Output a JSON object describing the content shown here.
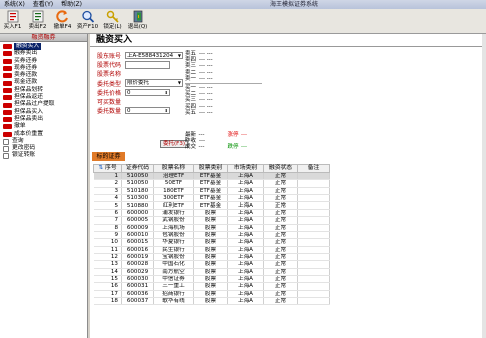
{
  "menu": [
    "系统(X)",
    "查看(Y)",
    "帮助(Z)"
  ],
  "app_title": "海王模拟证券系统",
  "toolbar": [
    {
      "label": "买入F1",
      "icon": "buy-icon"
    },
    {
      "label": "卖出F2",
      "icon": "sell-icon"
    },
    {
      "label": "撤单F4",
      "icon": "cancel-order-icon"
    },
    {
      "label": "资产F10",
      "icon": "search-icon"
    },
    {
      "label": "锁定(L)",
      "icon": "key-icon"
    },
    {
      "label": "退出(Q)",
      "icon": "exit-icon"
    }
  ],
  "sidebar": {
    "header": "融资融券",
    "items": [
      {
        "label": "融资买入",
        "selected": true
      },
      {
        "label": "融券卖出"
      },
      {
        "label": "买券还券"
      },
      {
        "label": "现券还券"
      },
      {
        "label": "卖券还款"
      },
      {
        "label": "现金还款"
      },
      {
        "label": "担保品划转"
      },
      {
        "label": "担保品返还"
      },
      {
        "label": "担保品过户提取"
      },
      {
        "label": "担保品买入"
      },
      {
        "label": "担保品卖出"
      },
      {
        "label": "撤单"
      },
      {
        "label": "成本价重置"
      },
      {
        "label": "查询",
        "tree": true
      },
      {
        "label": "更改密码",
        "tree": true
      },
      {
        "label": "银证转账",
        "tree": true
      }
    ]
  },
  "panel_title": "融资买入",
  "form": {
    "account_label": "股东账号",
    "account_value": "上A-E588431204",
    "code_label": "股票代码",
    "name_label": "股票名称",
    "type_label": "委托类型",
    "type_value": "限价委托",
    "price_label": "委托价格",
    "price_value": "0",
    "max_label": "可买数量",
    "qty_label": "委托数量",
    "qty_value": "0",
    "confirm_label": "委托(F3)"
  },
  "quote": {
    "sell": [
      {
        "k": "卖五",
        "v": "---   ---"
      },
      {
        "k": "卖四",
        "v": "---   ---"
      },
      {
        "k": "卖三",
        "v": "---   ---"
      },
      {
        "k": "卖二",
        "v": "---   ---"
      },
      {
        "k": "卖一",
        "v": "---   ---"
      }
    ],
    "buy": [
      {
        "k": "买一",
        "v": "---   ---"
      },
      {
        "k": "买二",
        "v": "---   ---"
      },
      {
        "k": "买三",
        "v": "---   ---"
      },
      {
        "k": "买四",
        "v": "---   ---"
      },
      {
        "k": "买五",
        "v": "---   ---"
      }
    ],
    "latest": {
      "k": "最新",
      "v": "---"
    },
    "close": {
      "k": "昨收",
      "v": "---"
    },
    "limit_up": {
      "k": "涨停",
      "v": "---"
    },
    "volume": {
      "k": "成交",
      "v": "---"
    },
    "limit_down": {
      "k": "跌停",
      "v": "---"
    }
  },
  "tab_label": "标的证券",
  "table": {
    "headers": [
      "序号",
      "证券代码",
      "股票名称",
      "股票类别",
      "市场类别",
      "融资状态",
      "备注"
    ],
    "rows": [
      [
        "1",
        "510050",
        "治理ETF",
        "ETF基金",
        "上海A",
        "正常",
        ""
      ],
      [
        "2",
        "510050",
        "50ETF",
        "ETF基金",
        "上海A",
        "正常",
        ""
      ],
      [
        "3",
        "510180",
        "180ETF",
        "ETF基金",
        "上海A",
        "正常",
        ""
      ],
      [
        "4",
        "510300",
        "300ETF",
        "ETF基金",
        "上海A",
        "正常",
        ""
      ],
      [
        "5",
        "510880",
        "红利ETF",
        "ETF基金",
        "上海A",
        "正常",
        ""
      ],
      [
        "6",
        "600000",
        "浦发银行",
        "股票",
        "上海A",
        "正常",
        ""
      ],
      [
        "7",
        "600005",
        "武钢股份",
        "股票",
        "上海A",
        "正常",
        ""
      ],
      [
        "8",
        "600009",
        "上海机场",
        "股票",
        "上海A",
        "正常",
        ""
      ],
      [
        "9",
        "600010",
        "包钢股份",
        "股票",
        "上海A",
        "正常",
        ""
      ],
      [
        "10",
        "600015",
        "华夏银行",
        "股票",
        "上海A",
        "正常",
        ""
      ],
      [
        "11",
        "600016",
        "民生银行",
        "股票",
        "上海A",
        "正常",
        ""
      ],
      [
        "12",
        "600019",
        "宝钢股份",
        "股票",
        "上海A",
        "正常",
        ""
      ],
      [
        "13",
        "600028",
        "中国石化",
        "股票",
        "上海A",
        "正常",
        ""
      ],
      [
        "14",
        "600029",
        "南方航空",
        "股票",
        "上海A",
        "正常",
        ""
      ],
      [
        "15",
        "600030",
        "中信证券",
        "股票",
        "上海A",
        "正常",
        ""
      ],
      [
        "16",
        "600031",
        "三一重工",
        "股票",
        "上海A",
        "正常",
        ""
      ],
      [
        "17",
        "600036",
        "招商银行",
        "股票",
        "上海A",
        "正常",
        ""
      ],
      [
        "18",
        "600037",
        "歌华有线",
        "股票",
        "上海A",
        "正常",
        ""
      ]
    ]
  }
}
